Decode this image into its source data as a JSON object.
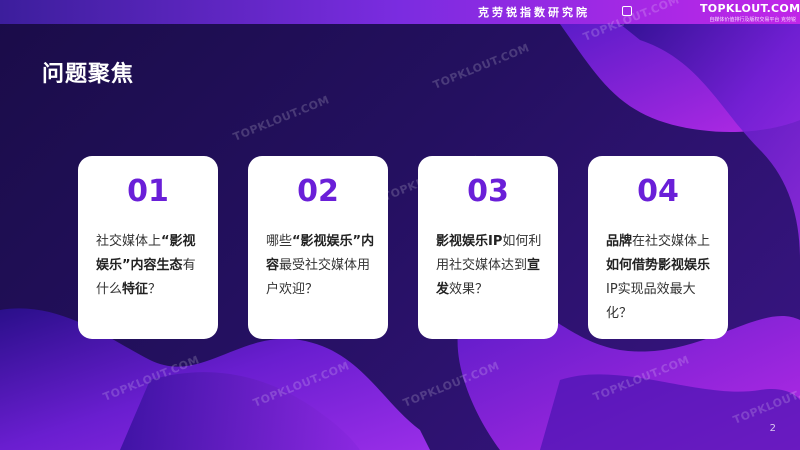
{
  "header": {
    "org_name": "克劳锐指数研究院",
    "brand_name": "TOPKLOUT.COM",
    "brand_tagline": "自媒体价值排行及版权交易平台 克劳锐"
  },
  "page": {
    "title": "问题聚焦",
    "page_number": "2",
    "watermark": "TOPKLOUT.COM"
  },
  "cards": [
    {
      "number": "01",
      "segments": [
        "社交媒体上",
        "“影视娱乐”",
        "内容生态",
        "有什么",
        "特征",
        "？"
      ]
    },
    {
      "number": "02",
      "segments": [
        "哪些",
        "“影视娱乐”内容",
        "最受社交媒体用户欢迎？"
      ]
    },
    {
      "number": "03",
      "segments": [
        "影视娱乐IP",
        "如何利用社交媒体达到",
        "宣发",
        "效果？"
      ]
    },
    {
      "number": "04",
      "segments": [
        "品牌",
        "在社交媒体上",
        "如何借势影视娱乐",
        "IP实现品效最大化？"
      ]
    }
  ],
  "colors": {
    "accent_number": "#6a1fd8",
    "topbar_start": "#3c1e9c",
    "topbar_end": "#c126e8",
    "background": "#1a0c48"
  }
}
